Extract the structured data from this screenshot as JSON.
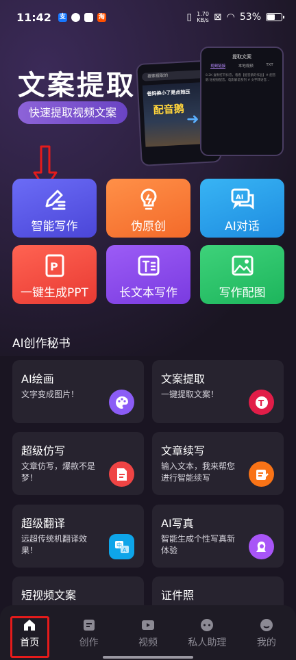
{
  "status_bar": {
    "time": "11:42",
    "net_speed_value": "1.70",
    "net_speed_unit": "KB/s",
    "battery": "53%",
    "battery_level": 0.53,
    "app_icons": [
      "alipay-icon",
      "messenger-icon",
      "mail-icon",
      "taobao-icon"
    ]
  },
  "hero": {
    "title": "文案提取",
    "subtitle": "快速提取视频文案",
    "mock_back_phone": {
      "search": "搜索提取的",
      "caption": "爸妈换小了是点她压",
      "sub_caption": "配音鹅"
    },
    "mock_front_phone": {
      "header": "提取文案",
      "tabs": [
        "视频链接",
        "本地视频",
        "TXT"
      ],
      "text": "8.2K 复制打开抖音，看看【配音鹅的作品】# 配音鹅 短视频配音，电影解说系列 # 文字转语音..."
    }
  },
  "tools": [
    {
      "label": "智能写作",
      "icon": "pen-write-icon"
    },
    {
      "label": "伪原创",
      "icon": "lightbulb-icon"
    },
    {
      "label": "AI对话",
      "icon": "ai-chat-icon"
    },
    {
      "label": "一键生成PPT",
      "icon": "ppt-icon"
    },
    {
      "label": "长文本写作",
      "icon": "text-doc-icon"
    },
    {
      "label": "写作配图",
      "icon": "image-icon"
    }
  ],
  "section_title": "AI创作秘书",
  "cards": [
    {
      "title": "AI绘画",
      "desc": "文字变成图片！",
      "icon": "palette-icon",
      "color": "#8b5cf6"
    },
    {
      "title": "文案提取",
      "desc": "一键提取文案！",
      "icon": "text-extract-icon",
      "color": "#e11d48"
    },
    {
      "title": "超级仿写",
      "desc": "文章仿写，爆款不是梦！",
      "icon": "doc-copy-icon",
      "color": "#ef4444"
    },
    {
      "title": "文章续写",
      "desc": "输入文本，我来帮您进行智能续写",
      "icon": "edit-doc-icon",
      "color": "#f97316"
    },
    {
      "title": "超级翻译",
      "desc": "远超传统机翻译效果！",
      "icon": "translate-icon",
      "color": "#0ea5e9"
    },
    {
      "title": "AI写真",
      "desc": "智能生成个性写真新体验",
      "icon": "portrait-icon",
      "color": "#a855f7"
    },
    {
      "title": "短视频文案",
      "desc": "",
      "icon": "",
      "color": ""
    },
    {
      "title": "证件照",
      "desc": "",
      "icon": "",
      "color": ""
    }
  ],
  "nav": [
    {
      "label": "首页",
      "icon": "home-icon",
      "active": true
    },
    {
      "label": "创作",
      "icon": "create-icon",
      "active": false
    },
    {
      "label": "视频",
      "icon": "video-icon",
      "active": false
    },
    {
      "label": "私人助理",
      "icon": "assistant-icon",
      "active": false
    },
    {
      "label": "我的",
      "icon": "profile-icon",
      "active": false
    }
  ],
  "colors": {
    "background": "#1a1522",
    "card": "#27232f",
    "accent": "#7a4fd6",
    "highlight_red": "#e51b1b"
  }
}
